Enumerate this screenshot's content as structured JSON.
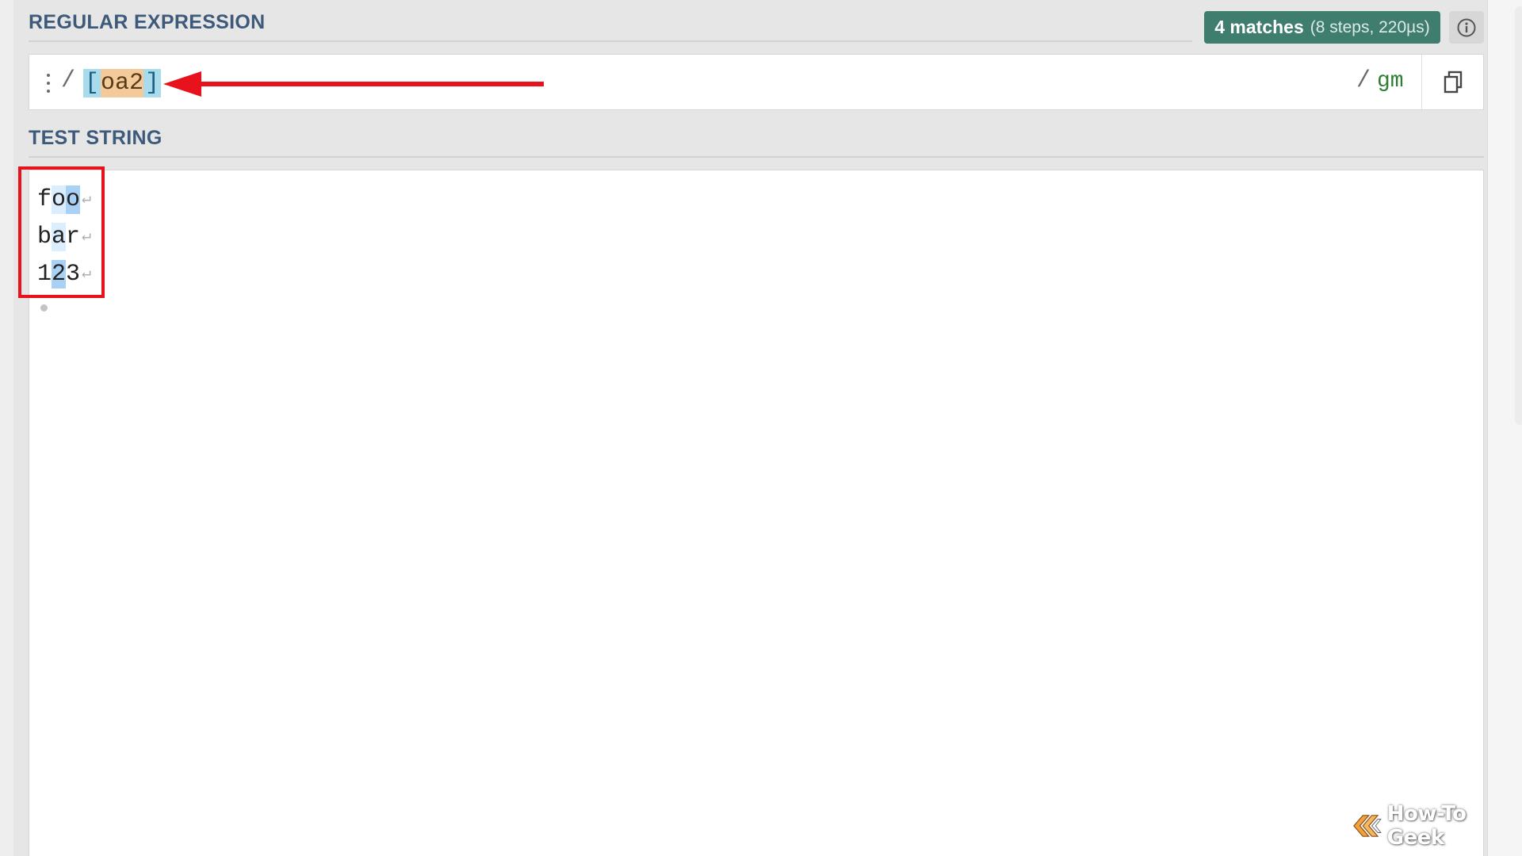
{
  "regex_section": {
    "label": "REGULAR EXPRESSION",
    "match_badge": {
      "count": "4 matches",
      "detail": "(8 steps, 220µs)"
    },
    "open_delimiter": "/",
    "pattern": {
      "open": "[",
      "chars": "oa2",
      "close": "]"
    },
    "close_delimiter": "/",
    "flags": "gm",
    "info_icon": "info-circle-icon",
    "copy_icon": "copy-icon",
    "handle_icon": "drag-handle-icon"
  },
  "test_section": {
    "label": "TEST STRING",
    "lines": [
      {
        "before": "f",
        "match1": "o",
        "match2": "o",
        "after": ""
      },
      {
        "before": "b",
        "match1": "a",
        "match2": "",
        "after": "r"
      },
      {
        "before": "1",
        "match1": "",
        "match2": "2",
        "after": "3"
      }
    ],
    "newline_symbol": "↵"
  },
  "annotations": {
    "arrow_color": "#e8121d",
    "box_color": "#e8121d"
  },
  "watermark": {
    "text": "How-To Geek",
    "logo_icon": "how-to-geek-logo-icon"
  },
  "colors": {
    "badge": "#3f7d6f",
    "section_label": "#3e5a7a",
    "flags": "#2e7d32",
    "match_light": "#dbeeff",
    "match_dark": "#a9d1f5"
  }
}
